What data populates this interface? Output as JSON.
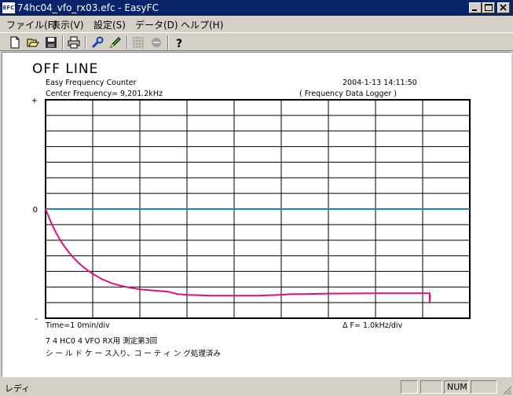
{
  "window": {
    "icon_text": "EFC",
    "title": "74hc04_vfo_rx03.efc - EasyFC"
  },
  "menu": [
    "ファイル(F)",
    "表示(V)",
    "設定(S)",
    "データ(D)",
    "ヘルプ(H)"
  ],
  "toolbar": {
    "icons": [
      "new-file-icon",
      "open-folder-icon",
      "save-icon",
      "print-icon",
      "wrench-settings-icon",
      "pen-marker-icon",
      "grid-disabled-icon",
      "stop-disabled-icon",
      "help-icon"
    ]
  },
  "view": {
    "status_title": "OFF LINE",
    "app_name": "Easy Frequency Counter",
    "datetime": "2004-1-13  14:11:50",
    "center_frequency": "Center Frequency=   9,201.2kHz",
    "mode": "( Frequency Data Logger )",
    "time_scale": "Time=1 0min/div",
    "freq_scale": "Δ F=    1.0kHz/div",
    "note_line1": "7 4 HC0 4   VFO   RX用    測定第3回",
    "note_line2": "シ ー ル ド ケ ー ス入り、コ ー テ ィ ン グ処理済み"
  },
  "chart_data": {
    "type": "line",
    "y_tick_labels": [
      "+",
      "0",
      "-"
    ],
    "xlabel": "Time=1 0min/div",
    "ylabel": "Δ F=    1.0kHz/div",
    "x_divisions": 9,
    "y_divisions": 14,
    "ylim": [
      -7,
      7
    ],
    "xlim": [
      0,
      90
    ],
    "zero_line_color": "#1a8ab0",
    "trace_color": "#e0107a",
    "grid": true,
    "series": [
      {
        "values": [
          [
            0,
            0.0
          ],
          [
            1,
            -0.75
          ],
          [
            2,
            -1.4
          ],
          [
            3,
            -1.95
          ],
          [
            4,
            -2.4
          ],
          [
            5,
            -2.8
          ],
          [
            6,
            -3.15
          ],
          [
            7,
            -3.45
          ],
          [
            8,
            -3.72
          ],
          [
            9,
            -3.95
          ],
          [
            10,
            -4.15
          ],
          [
            12,
            -4.5
          ],
          [
            14,
            -4.75
          ],
          [
            16,
            -4.92
          ],
          [
            18,
            -5.05
          ],
          [
            20,
            -5.15
          ],
          [
            22,
            -5.2
          ],
          [
            24,
            -5.25
          ],
          [
            26,
            -5.3
          ],
          [
            28,
            -5.45
          ],
          [
            30,
            -5.5
          ],
          [
            35,
            -5.55
          ],
          [
            40,
            -5.55
          ],
          [
            45,
            -5.55
          ],
          [
            50,
            -5.5
          ],
          [
            52,
            -5.45
          ],
          [
            55,
            -5.45
          ],
          [
            60,
            -5.42
          ],
          [
            70,
            -5.4
          ],
          [
            80,
            -5.4
          ],
          [
            81.5,
            -5.4
          ],
          [
            81.5,
            -6.0
          ],
          [
            81.6,
            -5.5
          ]
        ]
      }
    ]
  },
  "status": {
    "ready_text": "レディ",
    "num_indicator": "NUM"
  }
}
